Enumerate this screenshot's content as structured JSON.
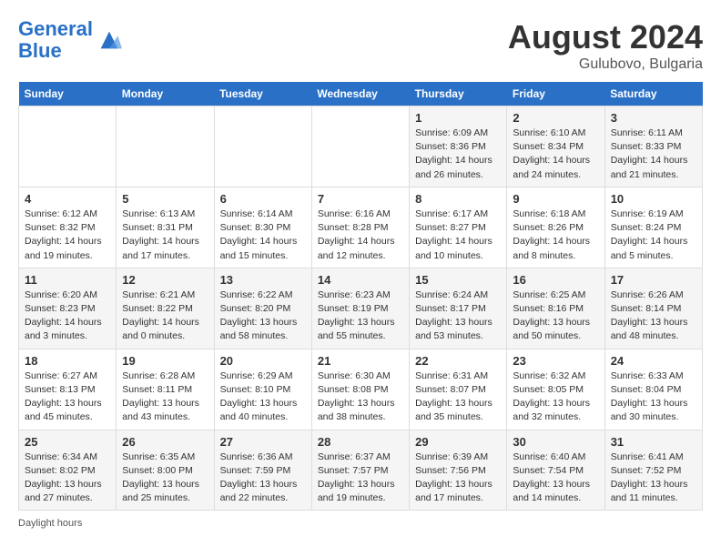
{
  "header": {
    "logo_line1": "General",
    "logo_line2": "Blue",
    "month_year": "August 2024",
    "location": "Gulubovo, Bulgaria"
  },
  "weekdays": [
    "Sunday",
    "Monday",
    "Tuesday",
    "Wednesday",
    "Thursday",
    "Friday",
    "Saturday"
  ],
  "weeks": [
    [
      {
        "day": "",
        "info": ""
      },
      {
        "day": "",
        "info": ""
      },
      {
        "day": "",
        "info": ""
      },
      {
        "day": "",
        "info": ""
      },
      {
        "day": "1",
        "info": "Sunrise: 6:09 AM\nSunset: 8:36 PM\nDaylight: 14 hours and 26 minutes."
      },
      {
        "day": "2",
        "info": "Sunrise: 6:10 AM\nSunset: 8:34 PM\nDaylight: 14 hours and 24 minutes."
      },
      {
        "day": "3",
        "info": "Sunrise: 6:11 AM\nSunset: 8:33 PM\nDaylight: 14 hours and 21 minutes."
      }
    ],
    [
      {
        "day": "4",
        "info": "Sunrise: 6:12 AM\nSunset: 8:32 PM\nDaylight: 14 hours and 19 minutes."
      },
      {
        "day": "5",
        "info": "Sunrise: 6:13 AM\nSunset: 8:31 PM\nDaylight: 14 hours and 17 minutes."
      },
      {
        "day": "6",
        "info": "Sunrise: 6:14 AM\nSunset: 8:30 PM\nDaylight: 14 hours and 15 minutes."
      },
      {
        "day": "7",
        "info": "Sunrise: 6:16 AM\nSunset: 8:28 PM\nDaylight: 14 hours and 12 minutes."
      },
      {
        "day": "8",
        "info": "Sunrise: 6:17 AM\nSunset: 8:27 PM\nDaylight: 14 hours and 10 minutes."
      },
      {
        "day": "9",
        "info": "Sunrise: 6:18 AM\nSunset: 8:26 PM\nDaylight: 14 hours and 8 minutes."
      },
      {
        "day": "10",
        "info": "Sunrise: 6:19 AM\nSunset: 8:24 PM\nDaylight: 14 hours and 5 minutes."
      }
    ],
    [
      {
        "day": "11",
        "info": "Sunrise: 6:20 AM\nSunset: 8:23 PM\nDaylight: 14 hours and 3 minutes."
      },
      {
        "day": "12",
        "info": "Sunrise: 6:21 AM\nSunset: 8:22 PM\nDaylight: 14 hours and 0 minutes."
      },
      {
        "day": "13",
        "info": "Sunrise: 6:22 AM\nSunset: 8:20 PM\nDaylight: 13 hours and 58 minutes."
      },
      {
        "day": "14",
        "info": "Sunrise: 6:23 AM\nSunset: 8:19 PM\nDaylight: 13 hours and 55 minutes."
      },
      {
        "day": "15",
        "info": "Sunrise: 6:24 AM\nSunset: 8:17 PM\nDaylight: 13 hours and 53 minutes."
      },
      {
        "day": "16",
        "info": "Sunrise: 6:25 AM\nSunset: 8:16 PM\nDaylight: 13 hours and 50 minutes."
      },
      {
        "day": "17",
        "info": "Sunrise: 6:26 AM\nSunset: 8:14 PM\nDaylight: 13 hours and 48 minutes."
      }
    ],
    [
      {
        "day": "18",
        "info": "Sunrise: 6:27 AM\nSunset: 8:13 PM\nDaylight: 13 hours and 45 minutes."
      },
      {
        "day": "19",
        "info": "Sunrise: 6:28 AM\nSunset: 8:11 PM\nDaylight: 13 hours and 43 minutes."
      },
      {
        "day": "20",
        "info": "Sunrise: 6:29 AM\nSunset: 8:10 PM\nDaylight: 13 hours and 40 minutes."
      },
      {
        "day": "21",
        "info": "Sunrise: 6:30 AM\nSunset: 8:08 PM\nDaylight: 13 hours and 38 minutes."
      },
      {
        "day": "22",
        "info": "Sunrise: 6:31 AM\nSunset: 8:07 PM\nDaylight: 13 hours and 35 minutes."
      },
      {
        "day": "23",
        "info": "Sunrise: 6:32 AM\nSunset: 8:05 PM\nDaylight: 13 hours and 32 minutes."
      },
      {
        "day": "24",
        "info": "Sunrise: 6:33 AM\nSunset: 8:04 PM\nDaylight: 13 hours and 30 minutes."
      }
    ],
    [
      {
        "day": "25",
        "info": "Sunrise: 6:34 AM\nSunset: 8:02 PM\nDaylight: 13 hours and 27 minutes."
      },
      {
        "day": "26",
        "info": "Sunrise: 6:35 AM\nSunset: 8:00 PM\nDaylight: 13 hours and 25 minutes."
      },
      {
        "day": "27",
        "info": "Sunrise: 6:36 AM\nSunset: 7:59 PM\nDaylight: 13 hours and 22 minutes."
      },
      {
        "day": "28",
        "info": "Sunrise: 6:37 AM\nSunset: 7:57 PM\nDaylight: 13 hours and 19 minutes."
      },
      {
        "day": "29",
        "info": "Sunrise: 6:39 AM\nSunset: 7:56 PM\nDaylight: 13 hours and 17 minutes."
      },
      {
        "day": "30",
        "info": "Sunrise: 6:40 AM\nSunset: 7:54 PM\nDaylight: 13 hours and 14 minutes."
      },
      {
        "day": "31",
        "info": "Sunrise: 6:41 AM\nSunset: 7:52 PM\nDaylight: 13 hours and 11 minutes."
      }
    ]
  ],
  "footer": {
    "daylight_label": "Daylight hours"
  }
}
